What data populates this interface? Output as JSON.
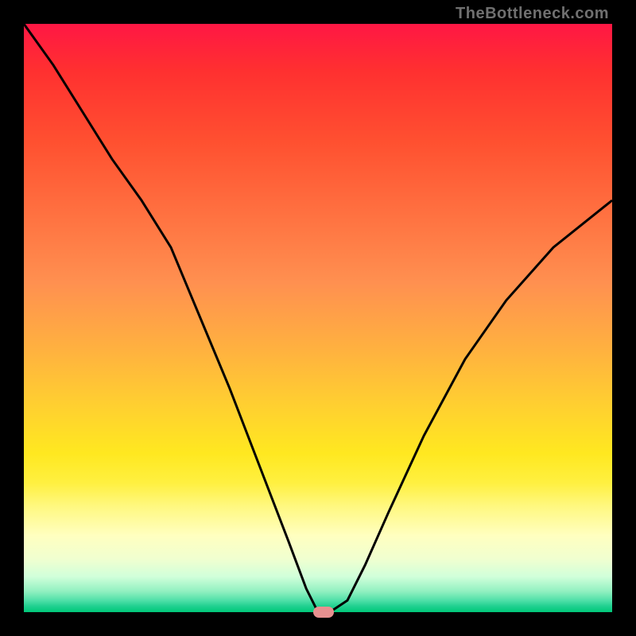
{
  "watermark": "TheBottleneck.com",
  "chart_data": {
    "type": "line",
    "title": "",
    "xlabel": "",
    "ylabel": "",
    "xlim": [
      0,
      100
    ],
    "ylim": [
      0,
      100
    ],
    "series": [
      {
        "name": "bottleneck-curve",
        "x": [
          0,
          5,
          10,
          15,
          20,
          25,
          30,
          35,
          40,
          45,
          48,
          50,
          52,
          55,
          58,
          62,
          68,
          75,
          82,
          90,
          100
        ],
        "values": [
          100,
          93,
          85,
          77,
          70,
          62,
          50,
          38,
          25,
          12,
          4,
          0,
          0,
          2,
          8,
          17,
          30,
          43,
          53,
          62,
          70
        ]
      }
    ],
    "marker": {
      "x": 51,
      "y": 0,
      "color": "#e89090"
    },
    "background_gradient": {
      "top": "#ff1744",
      "mid": "#ffd030",
      "bottom": "#00c878"
    }
  }
}
